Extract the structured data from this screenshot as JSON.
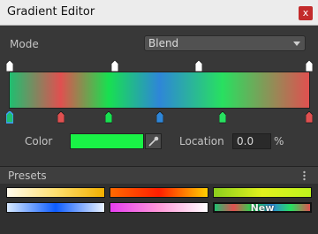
{
  "window": {
    "title": "Gradient Editor",
    "close_label": "x",
    "close_color": "#c32b2b"
  },
  "mode": {
    "label": "Mode",
    "value": "Blend"
  },
  "gradient": {
    "alpha_keys": [
      {
        "location": 0.0,
        "color": "#ffffff"
      },
      {
        "location": 0.35,
        "color": "#ffffff"
      },
      {
        "location": 0.63,
        "color": "#ffffff"
      },
      {
        "location": 1.0,
        "color": "#ffffff"
      }
    ],
    "color_keys": [
      {
        "location": 0.0,
        "color": "#1fbf70",
        "selected": true
      },
      {
        "location": 0.17,
        "color": "#e05050"
      },
      {
        "location": 0.33,
        "color": "#18e050"
      },
      {
        "location": 0.5,
        "color": "#2e86d8"
      },
      {
        "location": 0.71,
        "color": "#28e060"
      },
      {
        "location": 1.0,
        "color": "#e05050"
      }
    ],
    "stops": [
      {
        "offset": 0.0,
        "color": "#1fbf70"
      },
      {
        "offset": 0.17,
        "color": "#e05050"
      },
      {
        "offset": 0.33,
        "color": "#18e050"
      },
      {
        "offset": 0.5,
        "color": "#2e86d8"
      },
      {
        "offset": 0.71,
        "color": "#28e060"
      },
      {
        "offset": 1.0,
        "color": "#e05050"
      }
    ]
  },
  "color_field": {
    "label": "Color",
    "value": "#19f246"
  },
  "location_field": {
    "label": "Location",
    "value": "0.0",
    "unit": "%"
  },
  "presets": {
    "title": "Presets",
    "items": [
      {
        "name": "preset-1",
        "stops": [
          "#fffbee",
          "#ffe070",
          "#f3b000"
        ]
      },
      {
        "name": "preset-2",
        "stops": [
          "#ff6a00",
          "#ff1e00",
          "#ffd000"
        ]
      },
      {
        "name": "preset-3",
        "stops": [
          "#8bcf1d",
          "#e2f11d",
          "#bdf21d"
        ]
      },
      {
        "name": "preset-4",
        "stops": [
          "#d8eaff",
          "#0d5cff",
          "#eaf3ff"
        ]
      },
      {
        "name": "preset-5",
        "stops": [
          "#e63df0",
          "#ff9ad9",
          "#ffffff"
        ]
      },
      {
        "name": "preset-new",
        "stops": [
          "#1fbf70",
          "#e05050",
          "#18e050",
          "#2e86d8",
          "#28e060",
          "#e05050"
        ],
        "label": "New"
      }
    ]
  }
}
